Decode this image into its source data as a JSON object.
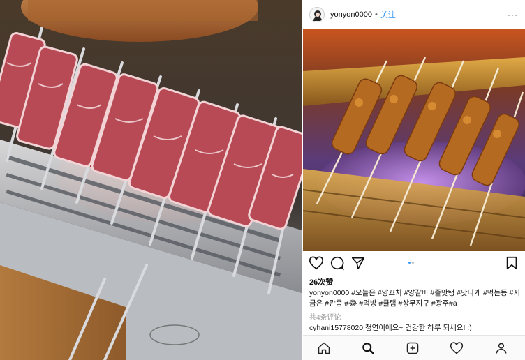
{
  "post": {
    "username": "yonyon0000",
    "separator": "•",
    "follow_label": "关注",
    "more_label": "···",
    "likes": "26次赞",
    "caption_user": "yonyon0000",
    "caption_text": "#오늘은 #양꼬치 #양갈비 #졸맛탱 #맛나게 #먹는듕 #지금은 #관종 #😂 #먹방 #클램 #상무지구 #광주#a",
    "comments_count": "共4条评论",
    "comment_user": "cyhani15778020",
    "comment_text": "청연이에요~ 건강한 하루 되세요! :)"
  },
  "icons": {
    "like": "heart-icon",
    "comment": "comment-icon",
    "share": "send-icon",
    "save": "bookmark-icon",
    "more": "more-dots-icon",
    "home": "home-icon",
    "search": "search-icon",
    "add": "add-post-icon",
    "activity": "activity-heart-icon",
    "profile": "profile-icon"
  },
  "carousel": {
    "total": 2,
    "current": 1
  },
  "colors": {
    "link_blue": "#3897f0",
    "text": "#111111",
    "muted": "#999999"
  }
}
